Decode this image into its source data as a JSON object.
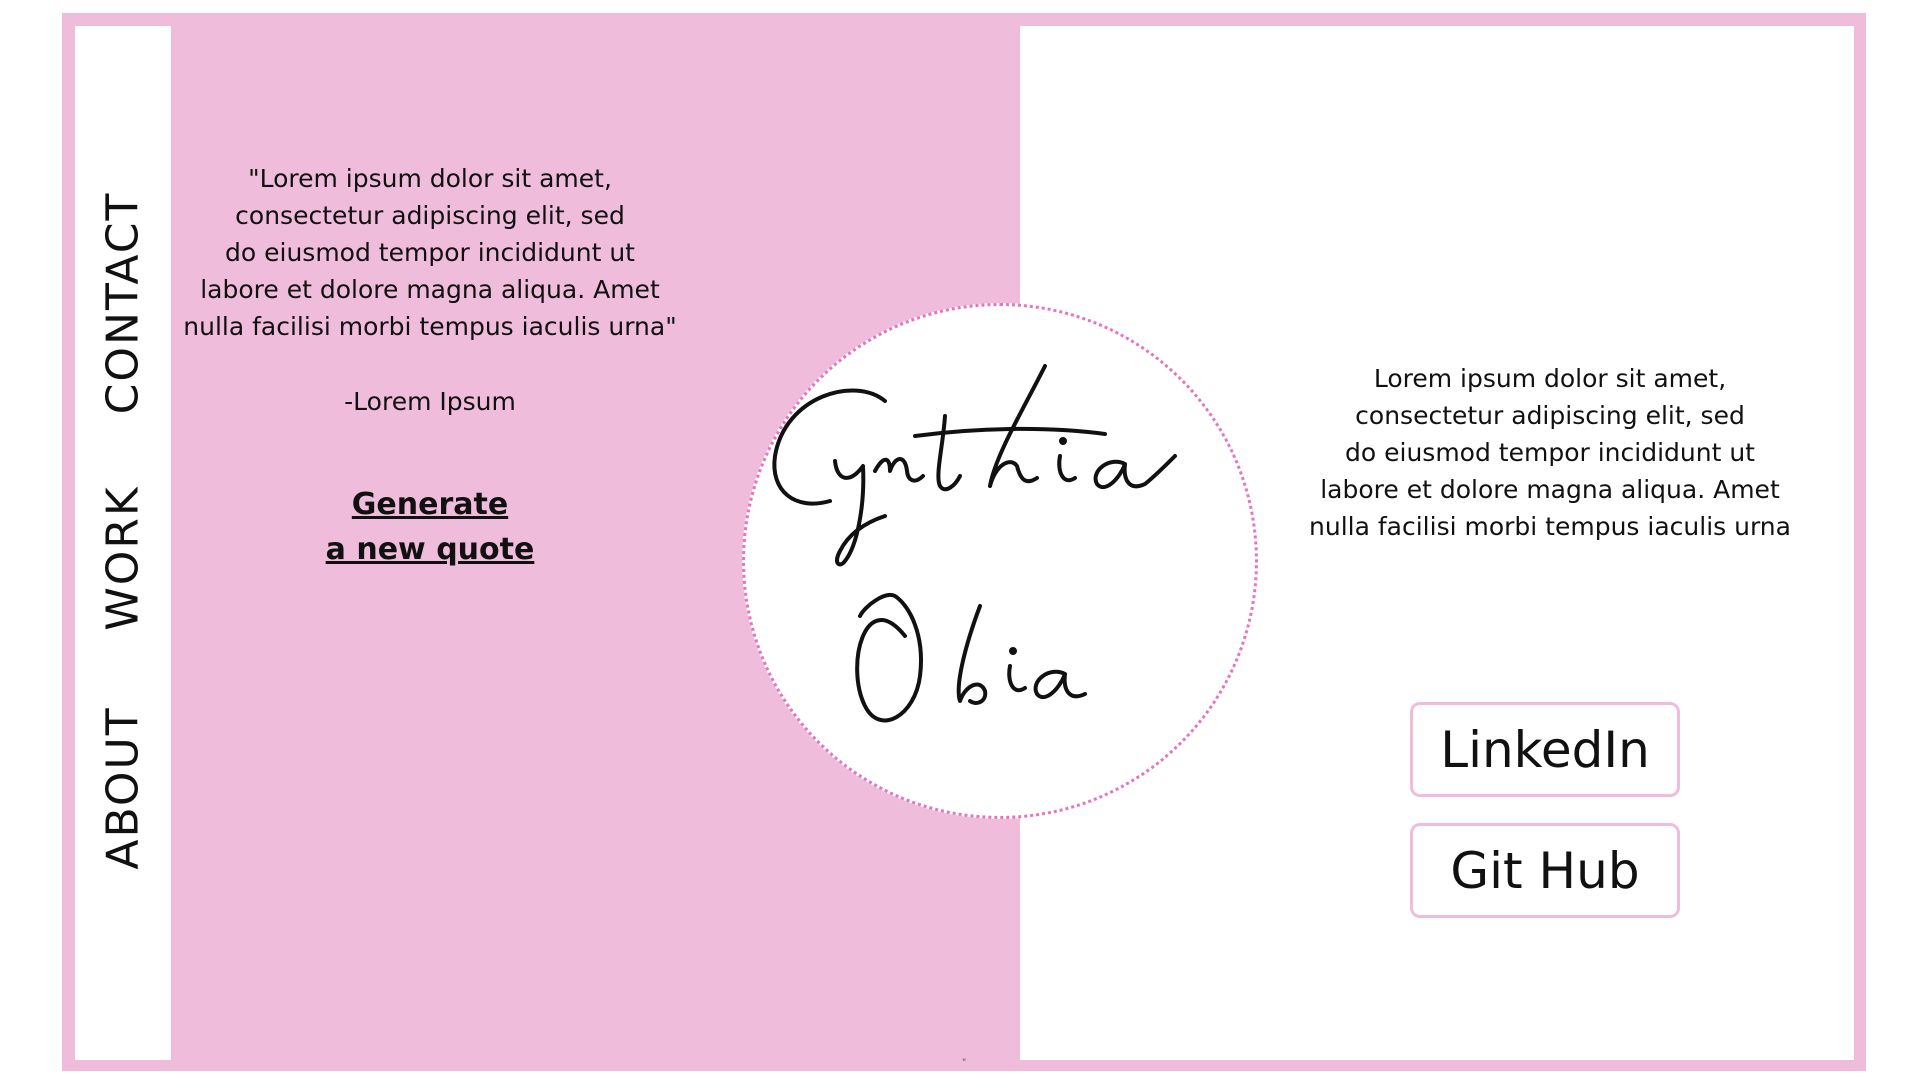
{
  "nav": {
    "items": [
      {
        "label": "CONTACT"
      },
      {
        "label": "WORK"
      },
      {
        "label": "ABOUT"
      }
    ]
  },
  "quote": {
    "text": "\"Lorem ipsum dolor sit amet,\nconsectetur adipiscing elit, sed\ndo eiusmod tempor incididunt ut\nlabore et dolore magna aliqua. Amet\nnulla facilisi morbi tempus iaculis urna\"",
    "author": "-Lorem Ipsum",
    "generate_label": "Generate\na new quote"
  },
  "logo": {
    "first_name": "Cynthia",
    "last_name": "Obia"
  },
  "about": {
    "text": "Lorem ipsum dolor sit amet,\nconsectetur adipiscing elit, sed\ndo eiusmod tempor incididunt ut\nlabore et dolore magna aliqua. Amet\nnulla facilisi morbi tempus iaculis urna"
  },
  "social": {
    "linkedin_label": "LinkedIn",
    "github_label": "Git Hub"
  },
  "footer": {
    "mark": "\""
  },
  "colors": {
    "brand_pink": "#efbcdc",
    "circle_border": "#e575bd",
    "background": "#ffffff",
    "text": "#111111"
  }
}
